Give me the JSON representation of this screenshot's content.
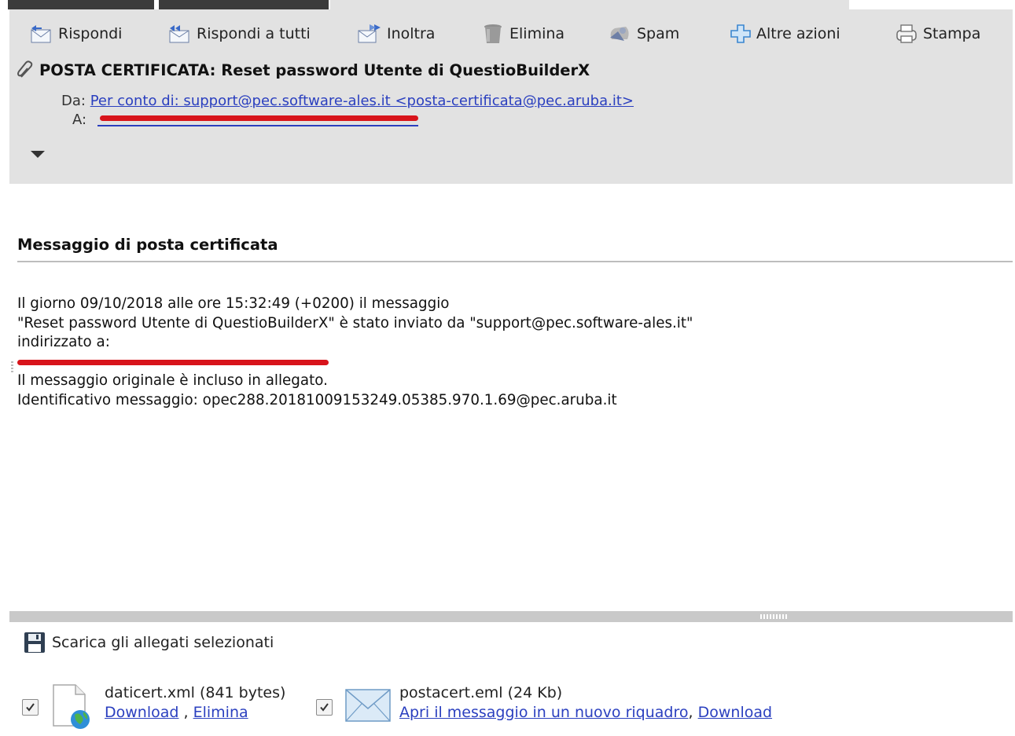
{
  "toolbar": {
    "reply": "Rispondi",
    "reply_all": "Rispondi a tutti",
    "forward": "Inoltra",
    "delete": "Elimina",
    "spam": "Spam",
    "more_actions": "Altre azioni",
    "print": "Stampa"
  },
  "message": {
    "subject": "POSTA CERTIFICATA: Reset password Utente di QuestioBuilderX",
    "from_label": "Da:",
    "from_value": "Per conto di: support@pec.software-ales.it <posta-certificata@pec.aruba.it>",
    "to_label": "A:"
  },
  "body": {
    "title": "Messaggio di posta certificata",
    "line1": "Il giorno 09/10/2018 alle ore 15:32:49 (+0200) il messaggio",
    "line2": "\"Reset password Utente di QuestioBuilderX\" è stato inviato da \"support@pec.software-ales.it\"",
    "line3": "indirizzato a:",
    "line5": "Il messaggio originale è incluso in allegato.",
    "line6": "Identificativo messaggio: opec288.20181009153249.05385.970.1.69@pec.aruba.it"
  },
  "attachments": {
    "download_selected": "Scarica gli allegati selezionati",
    "separator": ",",
    "items": [
      {
        "name": "daticert.xml (841 bytes)",
        "download": "Download",
        "delete": "Elimina"
      },
      {
        "name": "postacert.eml (24 Kb)",
        "open": "Apri il messaggio in un nuovo riquadro",
        "download": "Download"
      }
    ]
  },
  "colors": {
    "header_bg": "#e2e2e2",
    "link": "#2a3fbf",
    "redaction": "#d8141b"
  }
}
